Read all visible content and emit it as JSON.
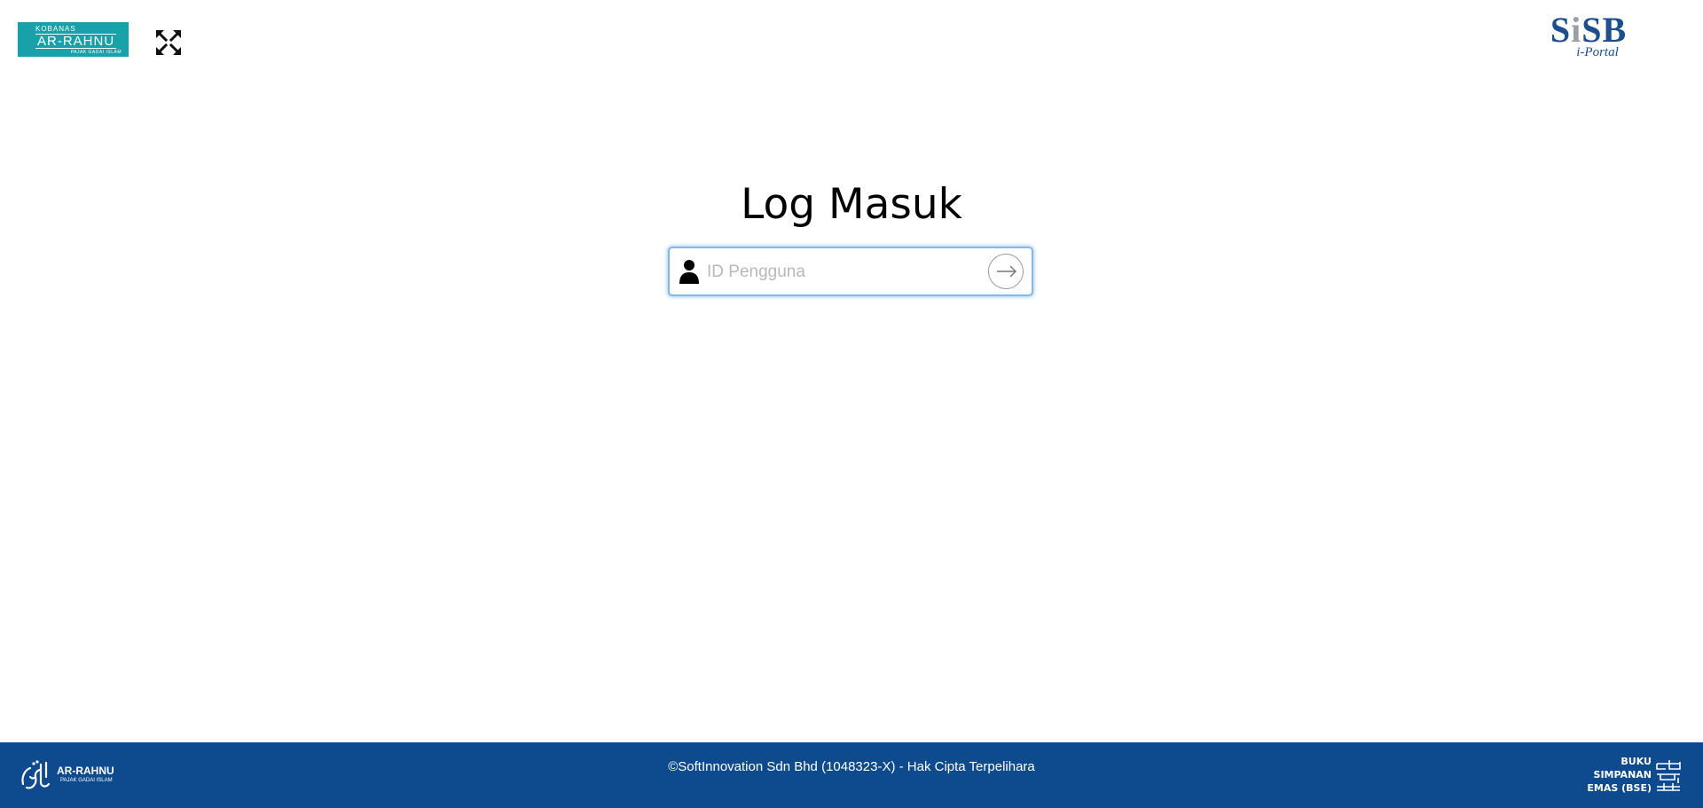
{
  "header": {
    "brand_logo": {
      "small": "KOBANAS",
      "big": "AR-RAHNU",
      "tiny": "PAJAK GADAI ISLAM"
    },
    "fullscreen_icon": "expand-icon",
    "sisb_logo": {
      "word_pre": "S",
      "word_i": "i",
      "word_post": "SB",
      "sub": "i-Portal"
    }
  },
  "login": {
    "title": "Log Masuk",
    "user_input_placeholder": "ID Pengguna",
    "user_input_value": "",
    "user_icon": "user-icon",
    "submit_icon": "arrow-right-icon"
  },
  "footer": {
    "copyright": "©SoftInnovation Sdn Bhd (1048323-X) - Hak Cipta Terpelihara",
    "left_logo": {
      "name": "AR-RAHNU",
      "tag": "PAJAK GADAI ISLAM"
    },
    "right_logo": {
      "line1": "BUKU",
      "line2": "SIMPANAN",
      "line3": "EMAS (BSE)"
    }
  },
  "colors": {
    "brand_teal": "#17a2a9",
    "footer_blue": "#0e4a8e",
    "sisb_blue": "#1d4f8c",
    "input_focus": "#87b7e3"
  }
}
